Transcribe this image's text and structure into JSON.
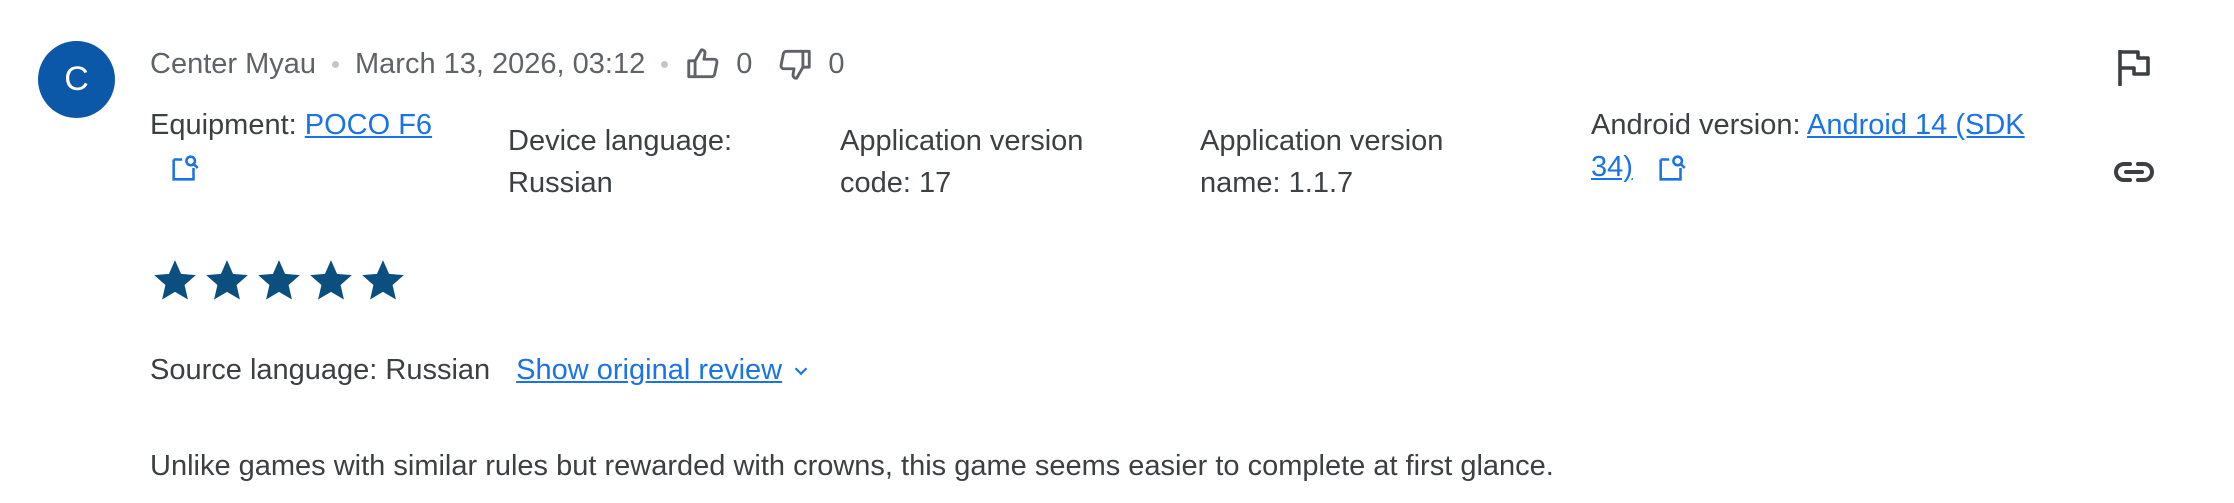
{
  "review": {
    "avatar_letter": "C",
    "author": "Center Myau",
    "date": "March 13, 2026, 03:12",
    "thumbs_up_count": "0",
    "thumbs_down_count": "0",
    "equipment_label": "Equipment:",
    "equipment_value": "POCO F6",
    "device_language_label": "Device language:",
    "device_language_value": "Russian",
    "app_version_code_label": "Application version",
    "app_version_code_value": "code: 17",
    "app_version_name_label": "Application version",
    "app_version_name_value": "name: 1.1.7",
    "android_version_label": "Android version:",
    "android_version_value_line1": "Android 14 (SDK",
    "android_version_value_line2": "34)",
    "rating": 5,
    "source_language": "Source language: Russian",
    "show_original_label": "Show original review",
    "text": "Unlike games with similar rules but rewarded with crowns, this game seems easier to complete at first glance."
  },
  "colors": {
    "avatar": "#0b57a8",
    "star": "#0b4f7f",
    "link": "#1a73e8"
  },
  "icons": {
    "flag": "flag-icon",
    "link": "link-icon",
    "thumb_up": "thumb-up-icon",
    "thumb_down": "thumb-down-icon",
    "external": "open-external-icon"
  }
}
